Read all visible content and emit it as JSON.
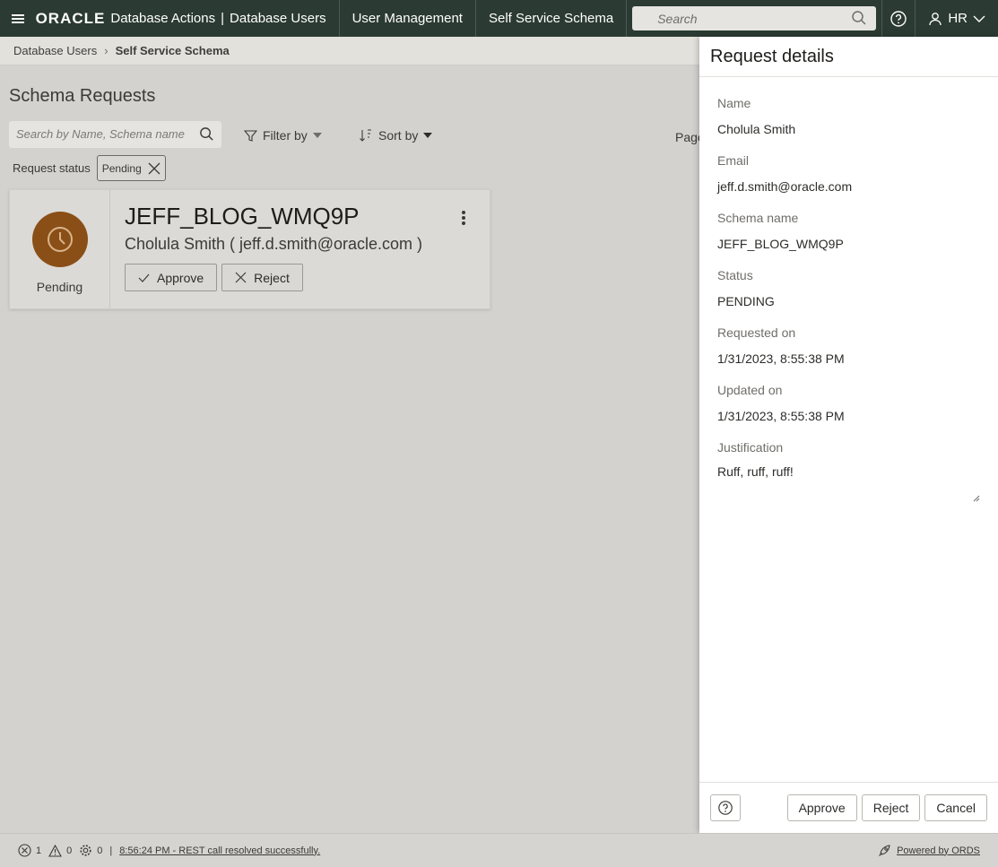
{
  "topbar": {
    "brand_logo": "ORACLE",
    "brand_product": "Database Actions",
    "brand_sep": "|",
    "brand_section": "Database Users",
    "nav": [
      "User Management",
      "Self Service Schema"
    ],
    "search_placeholder": "Search",
    "user": "HR"
  },
  "breadcrumb": {
    "parent": "Database Users",
    "current": "Self Service Schema"
  },
  "main": {
    "title": "Schema Requests",
    "search_placeholder": "Search by Name, Schema name",
    "filter_label": "Filter by",
    "sort_label": "Sort by",
    "page_label": "Page",
    "status_filter_label": "Request status",
    "status_chip": "Pending"
  },
  "card": {
    "schema": "JEFF_BLOG_WMQ9P",
    "requester": "Cholula Smith ( jeff.d.smith@oracle.com )",
    "status": "Pending",
    "approve_label": "Approve",
    "reject_label": "Reject",
    "status_color": "#8a4f17"
  },
  "drawer": {
    "title": "Request details",
    "fields": [
      {
        "label": "Name",
        "value": "Cholula Smith"
      },
      {
        "label": "Email",
        "value": "jeff.d.smith@oracle.com"
      },
      {
        "label": "Schema name",
        "value": "JEFF_BLOG_WMQ9P"
      },
      {
        "label": "Status",
        "value": "PENDING"
      },
      {
        "label": "Requested on",
        "value": "1/31/2023, 8:55:38 PM"
      },
      {
        "label": "Updated on",
        "value": "1/31/2023, 8:55:38 PM"
      }
    ],
    "justification_label": "Justification",
    "justification_value": "Ruff, ruff, ruff!",
    "approve": "Approve",
    "reject": "Reject",
    "cancel": "Cancel"
  },
  "statusbar": {
    "errors": "1",
    "warnings": "0",
    "tasks": "0",
    "separator": "|",
    "message": "8:56:24 PM - REST call resolved successfully.",
    "powered": "Powered by ORDS"
  },
  "colors": {
    "topbar": "#2b3a33",
    "status_pending": "#8a4f17"
  }
}
